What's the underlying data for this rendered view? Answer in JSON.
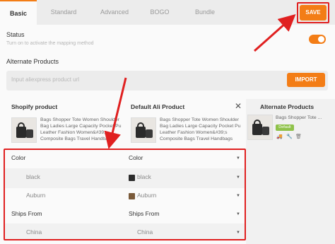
{
  "tabs": [
    "Basic",
    "Standard",
    "Advanced",
    "BOGO",
    "Bundle"
  ],
  "save_label": "SAVE",
  "status": {
    "title": "Status",
    "description": "Turn on to activate the mapping method",
    "enabled": true
  },
  "alternate": {
    "title": "Alternate Products",
    "placeholder": "Input aliexpress product url",
    "import_label": "IMPORT"
  },
  "columns": {
    "shopify": "Shopify product",
    "default_ali": "Default Ali Product",
    "alternate": "Alternate Products"
  },
  "product_title": "Bags Shopper Tote Women Shoulder Bag Ladies Large Capacity Pocket Pu Leather Fashion Women&#39;s Composite Bags Travel Handbags",
  "alt_product_title": "Bags Shopper Tote ...",
  "default_badge": "Default",
  "mapping": [
    {
      "left": "Color",
      "right": "Color",
      "type": "header"
    },
    {
      "left": "black",
      "right": "black",
      "type": "value"
    },
    {
      "left": "Auburn",
      "right": "Auburn",
      "type": "value"
    },
    {
      "left": "Ships From",
      "right": "Ships From",
      "type": "header"
    },
    {
      "left": "China",
      "right": "China",
      "type": "value"
    }
  ],
  "colors": {
    "accent": "#f37d16",
    "highlight": "#e02020",
    "badge": "#8fc24a"
  }
}
